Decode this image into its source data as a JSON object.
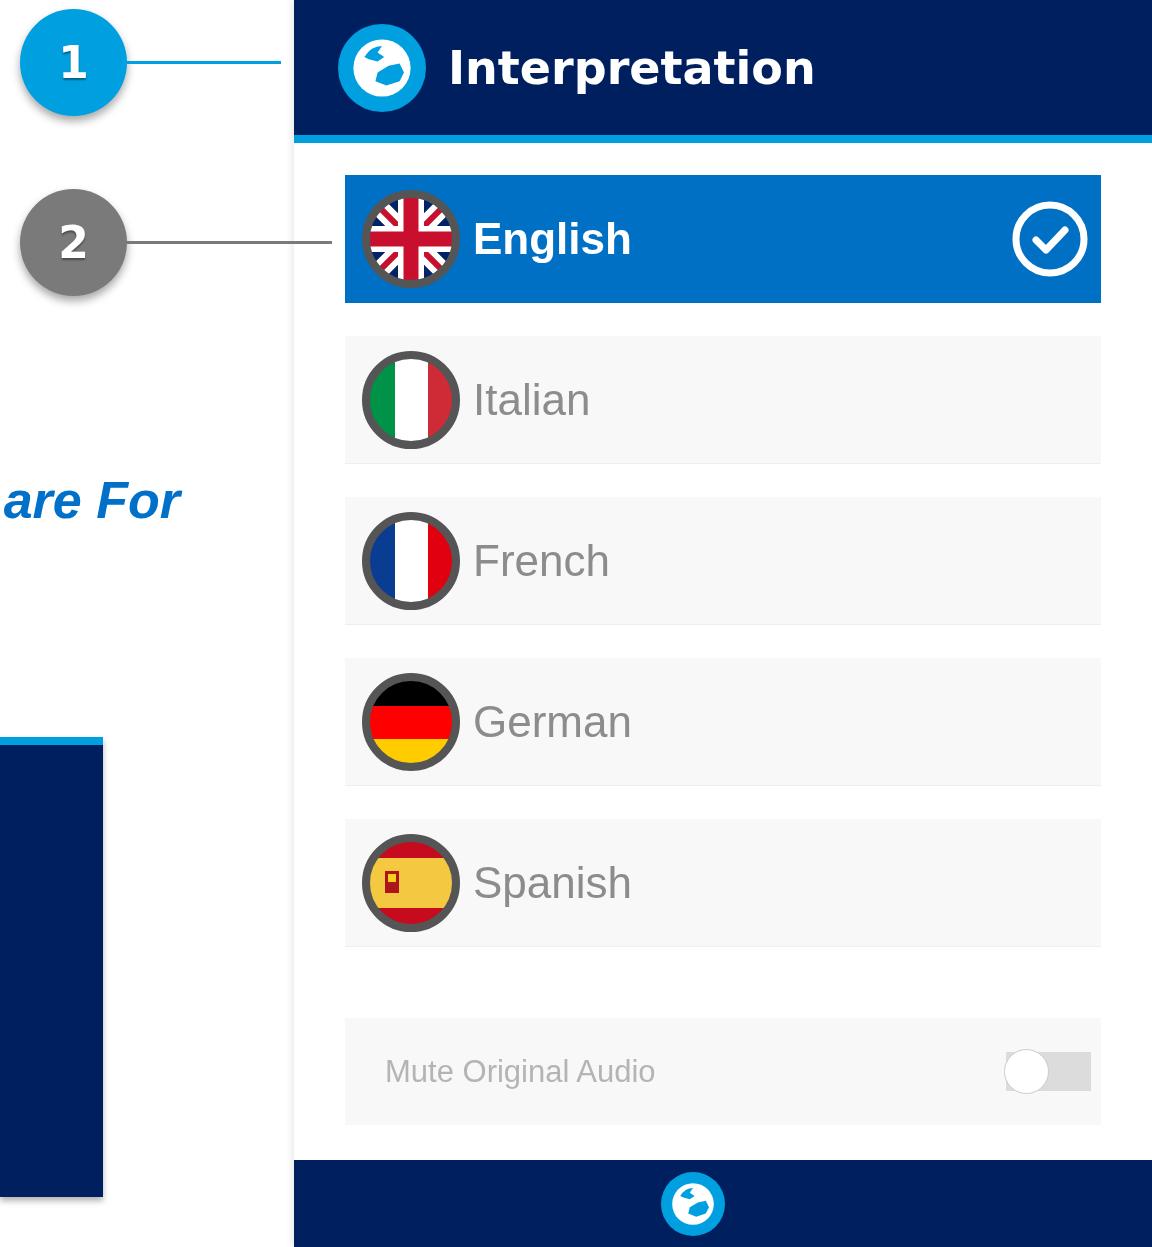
{
  "callouts": [
    {
      "number": "1",
      "color": "#00a0e0"
    },
    {
      "number": "2",
      "color": "#7a7a7a"
    }
  ],
  "background_heading": "are For",
  "panel": {
    "title": "Interpretation",
    "languages": [
      {
        "name": "English",
        "selected": true
      },
      {
        "name": "Italian",
        "selected": false
      },
      {
        "name": "French",
        "selected": false
      },
      {
        "name": "German",
        "selected": false
      },
      {
        "name": "Spanish",
        "selected": false
      }
    ],
    "mute_original_audio": {
      "label": "Mute Original Audio",
      "on": false
    }
  }
}
